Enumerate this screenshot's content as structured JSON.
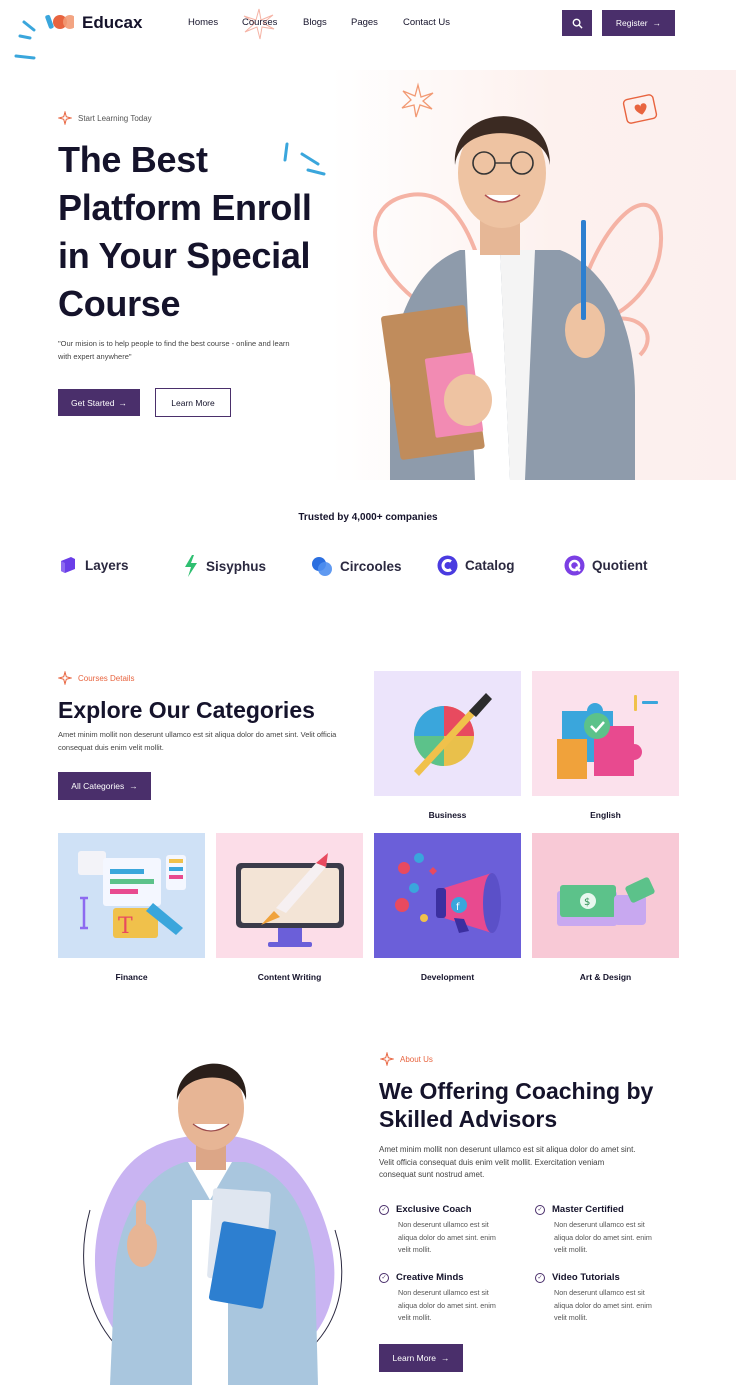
{
  "header": {
    "logo": "Educax",
    "nav": [
      "Homes",
      "Courses",
      "Blogs",
      "Pages",
      "Contact Us"
    ],
    "register_label": "Register",
    "arrow": "→"
  },
  "hero": {
    "tag": "Start Learning Today",
    "title_lines": [
      "The Best",
      "Platform Enroll",
      "in Your Special",
      "Course"
    ],
    "subtitle_line1": "\"Our mision is to help people to find the best course - online and learn",
    "subtitle_line2": "with expert anywhere\"",
    "primary_label": "Get Started",
    "secondary_label": "Learn More"
  },
  "trusted": {
    "heading": "Trusted by 4,000+ companies",
    "brands": [
      {
        "name": "Layers",
        "color": "#6a3ee8"
      },
      {
        "name": "Sisyphus",
        "color": "#2fbf71"
      },
      {
        "name": "Circooles",
        "color": "#2b6fe0"
      },
      {
        "name": "Catalog",
        "color": "#4a3be0"
      },
      {
        "name": "Quotient",
        "color": "#7b3fe4"
      }
    ]
  },
  "categories": {
    "tag": "Courses Details",
    "title": "Explore Our Categories",
    "para_line1": "Amet minim mollit non deserunt ullamco est sit aliqua dolor do amet sint. Velit officia",
    "para_line2": "consequat duis enim velit mollit.",
    "button_label": "All Categories",
    "items": [
      {
        "label": "Business",
        "bg": "#ece4fb"
      },
      {
        "label": "English",
        "bg": "#fbe1ec"
      },
      {
        "label": "Finance",
        "bg": "#cfe1f6"
      },
      {
        "label": "Content Writing",
        "bg": "#fcdde8"
      },
      {
        "label": "Development",
        "bg": "#6b5fd9"
      },
      {
        "label": "Art & Design",
        "bg": "#f8c9d6"
      }
    ]
  },
  "about": {
    "tag": "About Us",
    "title_line1": "We Offering Coaching by",
    "title_line2": "Skilled Advisors",
    "para_line1": "Amet minim mollit non deserunt ullamco est sit aliqua dolor do amet sint.",
    "para_line2": "Velit officia consequat duis enim velit mollit. Exercitation veniam",
    "para_line3": "consequat sunt nostrud amet.",
    "features": [
      {
        "title": "Exclusive Coach",
        "l1": "Non deserunt ullamco est sit",
        "l2": "aliqua dolor do amet sint. enim",
        "l3": "velit mollit."
      },
      {
        "title": "Master Certified",
        "l1": "Non deserunt ullamco est sit",
        "l2": "aliqua dolor do amet sint. enim",
        "l3": "velit mollit."
      },
      {
        "title": "Creative Minds",
        "l1": "Non deserunt ullamco est sit",
        "l2": "aliqua dolor do amet sint. enim",
        "l3": "velit mollit."
      },
      {
        "title": "Video Tutorials",
        "l1": "Non deserunt ullamco est sit",
        "l2": "aliqua dolor do amet sint. enim",
        "l3": "velit mollit."
      }
    ],
    "button_label": "Learn More"
  },
  "colors": {
    "accent": "#4a2f6b",
    "orange": "#e8643f",
    "pink": "#f5b3a5",
    "purple_blob": "#c9b4f2"
  },
  "icons": [
    "search-icon",
    "star-sparkle-icon",
    "arrow-right-icon",
    "check-circle-icon",
    "heart-chat-icon"
  ]
}
